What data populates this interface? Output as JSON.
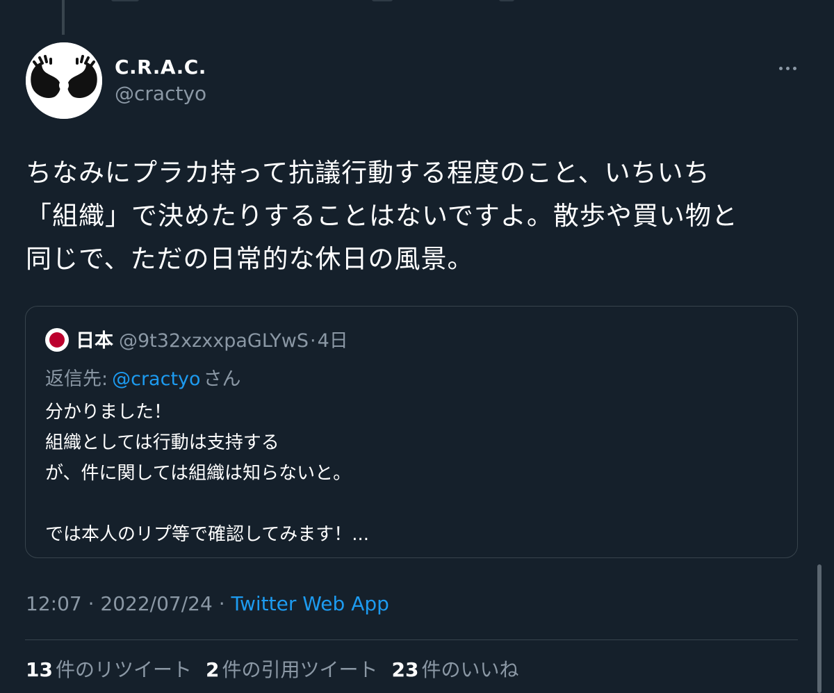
{
  "tweet": {
    "author_name": "C.R.A.C.",
    "author_handle": "@cractyo",
    "text": "ちなみにプラカ持って抗議行動する程度のこと、いちいち\n「組織」で決めたりすることはないですよ。散歩や買い物と\n同じで、ただの日常的な休日の風景。",
    "time": "12:07",
    "date": "2022/07/24",
    "source": "Twitter Web App",
    "separator": " · "
  },
  "quote": {
    "name": "日本",
    "handle": "@9t32xzxxpaGLYwS",
    "dot": "·",
    "time": "4日",
    "reply_prefix": "返信先:",
    "reply_handle": "@cractyo",
    "reply_suffix": "さん",
    "text": "分かりました！\n組織としては行動は支持する\nが、件に関しては組織は知らないと。\n\nでは本人のリプ等で確認してみます！..."
  },
  "stats": {
    "retweets_count": "13",
    "retweets_label": "件のリツイート",
    "quotes_count": "2",
    "quotes_label": "件の引用ツイート",
    "likes_count": "23",
    "likes_label": "件のいいね"
  },
  "colors": {
    "background": "#15202b",
    "link": "#1d9bf0",
    "secondary_text": "#8b98a5",
    "border": "#38444d"
  },
  "icons": {
    "more": "more-dots-icon",
    "avatar": "hands-heart-logo",
    "quote_avatar": "japan-flag-icon"
  }
}
